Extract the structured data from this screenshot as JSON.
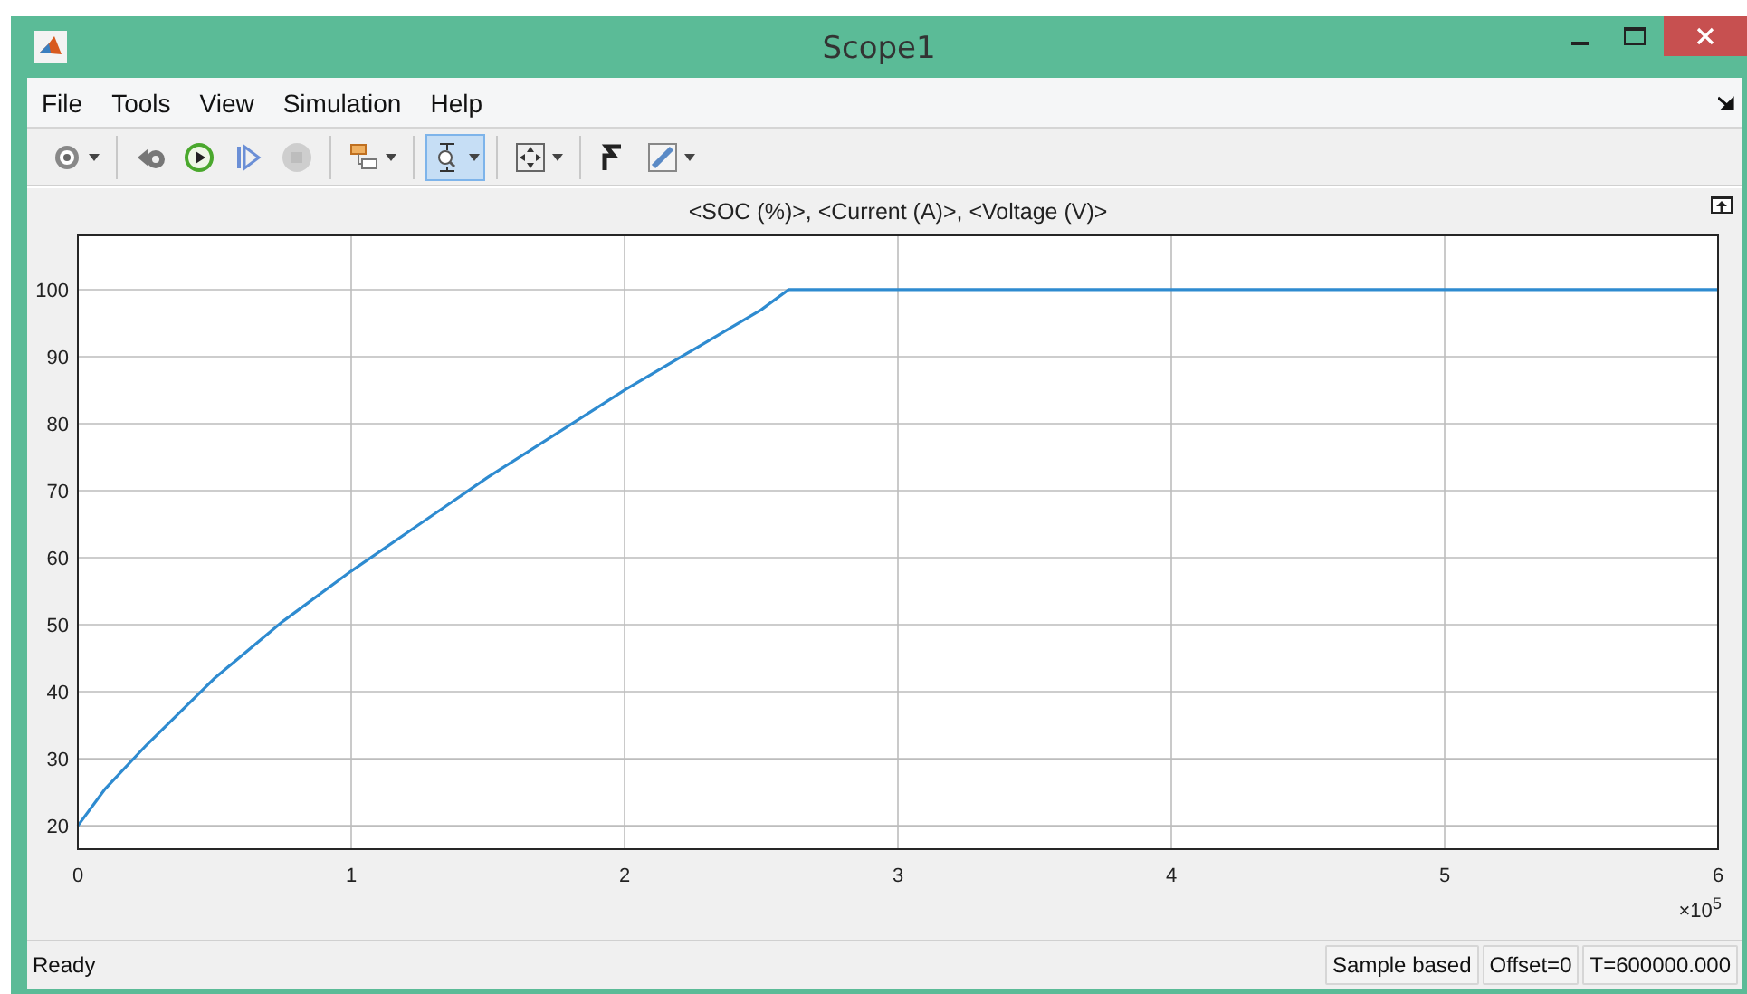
{
  "window": {
    "title": "Scope1"
  },
  "menu": [
    {
      "label": "File"
    },
    {
      "label": "Tools"
    },
    {
      "label": "View"
    },
    {
      "label": "Simulation"
    },
    {
      "label": "Help"
    }
  ],
  "toolbar": [
    {
      "buttons": [
        {
          "kind": "settings",
          "pressed": false,
          "disabled": false,
          "dropdown": true
        }
      ]
    },
    {
      "buttons": [
        {
          "kind": "step-back",
          "pressed": false,
          "disabled": false,
          "dropdown": false
        },
        {
          "kind": "run",
          "pressed": false,
          "disabled": false,
          "dropdown": false
        },
        {
          "kind": "step-forward",
          "pressed": false,
          "disabled": false,
          "dropdown": false
        },
        {
          "kind": "stop",
          "pressed": false,
          "disabled": true,
          "dropdown": false
        }
      ]
    },
    {
      "buttons": [
        {
          "kind": "highlight",
          "pressed": false,
          "disabled": false,
          "dropdown": true
        }
      ]
    },
    {
      "buttons": [
        {
          "kind": "zoom",
          "pressed": true,
          "disabled": false,
          "dropdown": true
        }
      ]
    },
    {
      "buttons": [
        {
          "kind": "fit",
          "pressed": false,
          "disabled": false,
          "dropdown": true
        }
      ]
    },
    {
      "buttons": [
        {
          "kind": "axes",
          "pressed": false,
          "disabled": false,
          "dropdown": false
        },
        {
          "kind": "style",
          "pressed": false,
          "disabled": false,
          "dropdown": true
        }
      ]
    }
  ],
  "plot": {
    "chart_data": {
      "type": "line",
      "title": "<SOC (%)>, <Current (A)>, <Voltage (V)>",
      "x": [
        0,
        0.1,
        0.25,
        0.5,
        0.75,
        1,
        1.25,
        1.5,
        1.75,
        2,
        2.25,
        2.5,
        2.6,
        3,
        4,
        5,
        6
      ],
      "grid": true,
      "series": [
        {
          "color": "#2e8bd0",
          "values": [
            20,
            25.5,
            32,
            42,
            50.5,
            58,
            65,
            72,
            78.5,
            85,
            91,
            97,
            100,
            100,
            100,
            100,
            100
          ]
        }
      ],
      "xlim": [
        0,
        6
      ],
      "ylim": [
        16.5,
        108.1
      ],
      "xticks": [
        0,
        1,
        2,
        3,
        4,
        5,
        6
      ],
      "yticks": [
        20,
        30,
        40,
        50,
        60,
        70,
        80,
        90,
        100
      ],
      "annotations": [
        "×10$^{5}$"
      ]
    }
  },
  "status_bar": {
    "message": "Ready",
    "panels": [
      "Sample based",
      "Offset=0",
      "T=600000.000"
    ]
  }
}
